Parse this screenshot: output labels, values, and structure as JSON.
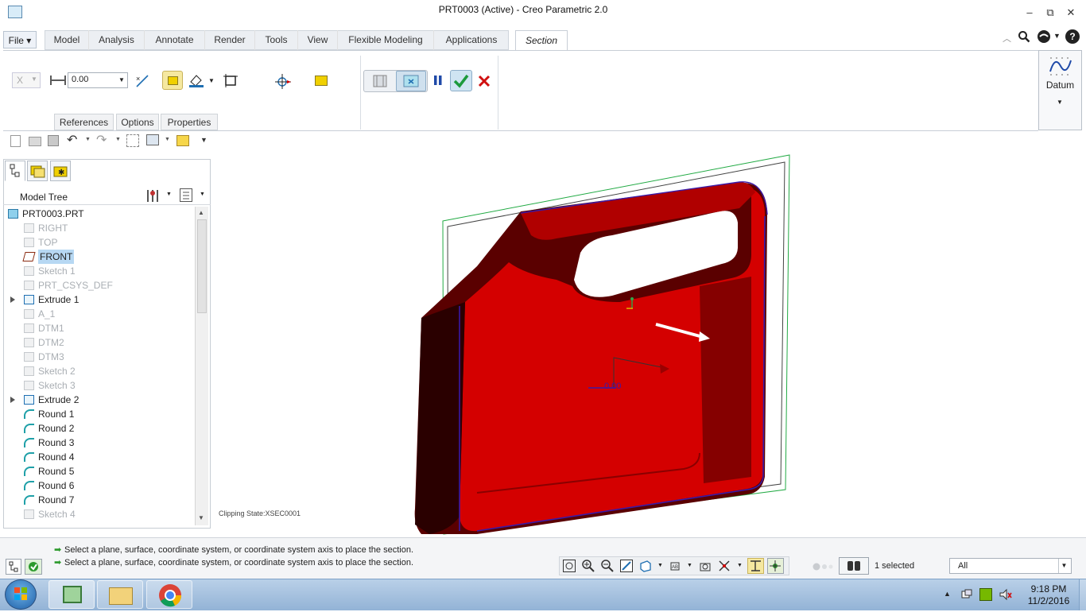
{
  "window": {
    "title": "PRT0003 (Active) - Creo Parametric 2.0",
    "min": "‒",
    "restore": "⧉",
    "close": "✕"
  },
  "menu": {
    "file": "File ▾",
    "tabs": [
      "Model",
      "Analysis",
      "Annotate",
      "Render",
      "Tools",
      "View",
      "Flexible Modeling",
      "Applications"
    ],
    "active_tab": "Section"
  },
  "ribbon": {
    "x_select": "X",
    "offset_value": "0.00",
    "subtabs": [
      "References",
      "Options",
      "Properties"
    ],
    "datum_label": "Datum"
  },
  "panel": {
    "tree_title": "Model Tree"
  },
  "tree": [
    {
      "label": "PRT0003.PRT",
      "dim": false,
      "expand": false
    },
    {
      "label": "RIGHT",
      "dim": true,
      "expand": false
    },
    {
      "label": "TOP",
      "dim": true,
      "expand": false
    },
    {
      "label": "FRONT",
      "dim": false,
      "expand": false,
      "selected": true
    },
    {
      "label": "Sketch 1",
      "dim": true,
      "expand": false
    },
    {
      "label": "PRT_CSYS_DEF",
      "dim": true,
      "expand": false
    },
    {
      "label": "Extrude 1",
      "dim": false,
      "expand": true
    },
    {
      "label": "A_1",
      "dim": true,
      "expand": false
    },
    {
      "label": "DTM1",
      "dim": true,
      "expand": false
    },
    {
      "label": "DTM2",
      "dim": true,
      "expand": false
    },
    {
      "label": "DTM3",
      "dim": true,
      "expand": false
    },
    {
      "label": "Sketch 2",
      "dim": true,
      "expand": false
    },
    {
      "label": "Sketch 3",
      "dim": true,
      "expand": false
    },
    {
      "label": "Extrude 2",
      "dim": false,
      "expand": true
    },
    {
      "label": "Round 1",
      "dim": false,
      "expand": false
    },
    {
      "label": "Round 2",
      "dim": false,
      "expand": false
    },
    {
      "label": "Round 3",
      "dim": false,
      "expand": false
    },
    {
      "label": "Round 4",
      "dim": false,
      "expand": false
    },
    {
      "label": "Round 5",
      "dim": false,
      "expand": false
    },
    {
      "label": "Round 6",
      "dim": false,
      "expand": false
    },
    {
      "label": "Round 7",
      "dim": false,
      "expand": false
    },
    {
      "label": "Sketch 4",
      "dim": true,
      "expand": false
    }
  ],
  "canvas": {
    "clip_state": "Clipping State:XSEC0001",
    "dim_value": "0.00"
  },
  "status": {
    "msg1": "Select a plane, surface, coordinate system, or coordinate system axis to place the section.",
    "msg2": "Select a plane, surface, coordinate system, or coordinate system axis to place the section.",
    "selected": "1 selected",
    "filter": "All"
  },
  "taskbar": {
    "time": "9:18 PM",
    "date": "11/2/2016"
  },
  "colors": {
    "part": "#d40000",
    "datum_plane": "#22aa44",
    "accent": "#1f6fb2"
  }
}
